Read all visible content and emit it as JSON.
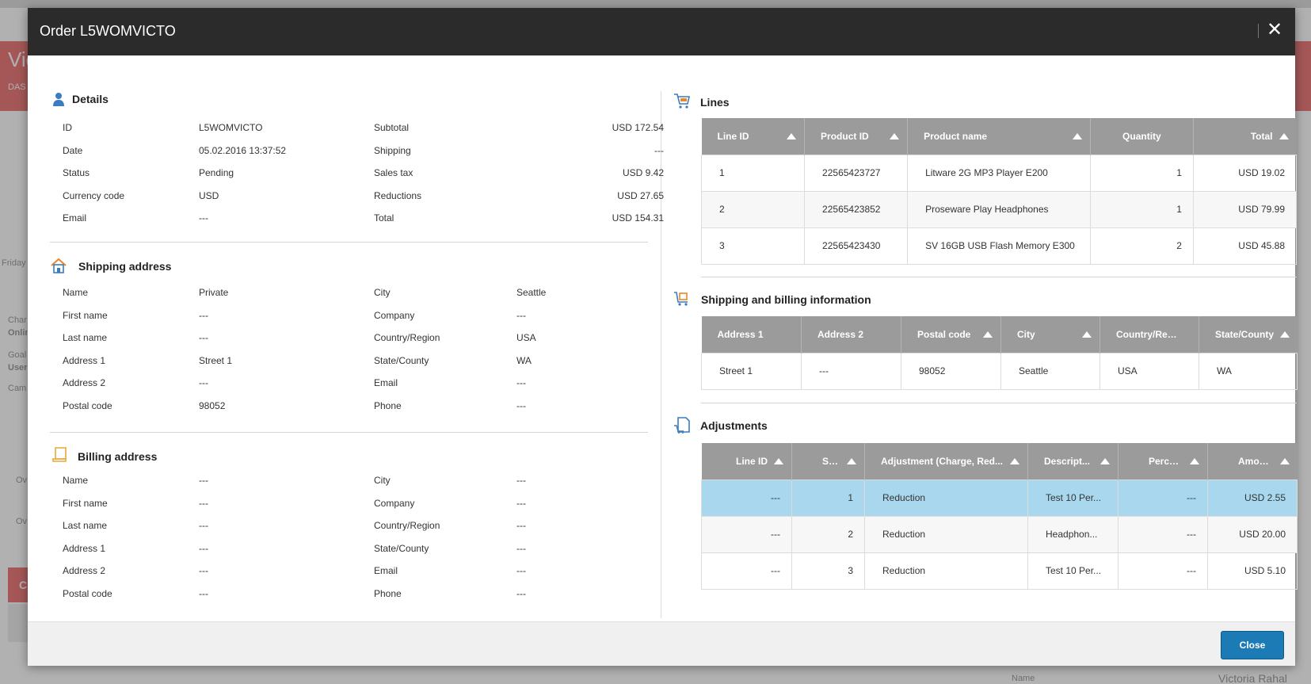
{
  "background": {
    "banner_title": "Vic",
    "banner_sub": "DAS",
    "side_texts": [
      "Friday S",
      "Char",
      "Onlin",
      "Goal",
      "User",
      "Cam",
      "Ov",
      "Ov",
      "C"
    ],
    "bottom_name_label": "Name",
    "bottom_name_value": "Victoria Rahal"
  },
  "dialog": {
    "title": "Order L5WOMVICTO",
    "close_button": "Close"
  },
  "details": {
    "title": "Details",
    "left": [
      {
        "label": "ID",
        "value": "L5WOMVICTO"
      },
      {
        "label": "Date",
        "value": "05.02.2016 13:37:52"
      },
      {
        "label": "Status",
        "value": "Pending"
      },
      {
        "label": "Currency code",
        "value": "USD"
      },
      {
        "label": "Email",
        "value": "---"
      }
    ],
    "right": [
      {
        "label": "Subtotal",
        "value": "USD 172.54"
      },
      {
        "label": "Shipping",
        "value": "---"
      },
      {
        "label": "Sales tax",
        "value": "USD 9.42"
      },
      {
        "label": "Reductions",
        "value": "USD 27.65"
      },
      {
        "label": "Total",
        "value": "USD 154.31"
      }
    ]
  },
  "shipping_address": {
    "title": "Shipping address",
    "left": [
      {
        "label": "Name",
        "value": "Private"
      },
      {
        "label": "First name",
        "value": "---"
      },
      {
        "label": "Last name",
        "value": "---"
      },
      {
        "label": "Address 1",
        "value": "Street 1"
      },
      {
        "label": "Address 2",
        "value": "---"
      },
      {
        "label": "Postal code",
        "value": "98052"
      }
    ],
    "right": [
      {
        "label": "City",
        "value": "Seattle"
      },
      {
        "label": "Company",
        "value": "---"
      },
      {
        "label": "Country/Region",
        "value": "USA"
      },
      {
        "label": "State/County",
        "value": "WA"
      },
      {
        "label": "Email",
        "value": "---"
      },
      {
        "label": "Phone",
        "value": "---"
      }
    ]
  },
  "billing_address": {
    "title": "Billing address",
    "left": [
      {
        "label": "Name",
        "value": "---"
      },
      {
        "label": "First name",
        "value": "---"
      },
      {
        "label": "Last name",
        "value": "---"
      },
      {
        "label": "Address 1",
        "value": "---"
      },
      {
        "label": "Address 2",
        "value": "---"
      },
      {
        "label": "Postal code",
        "value": "---"
      }
    ],
    "right": [
      {
        "label": "City",
        "value": "---"
      },
      {
        "label": "Company",
        "value": "---"
      },
      {
        "label": "Country/Region",
        "value": "---"
      },
      {
        "label": "State/County",
        "value": "---"
      },
      {
        "label": "Email",
        "value": "---"
      },
      {
        "label": "Phone",
        "value": "---"
      }
    ]
  },
  "lines": {
    "title": "Lines",
    "headers": [
      "Line ID",
      "Product ID",
      "Product name",
      "Quantity",
      "Total"
    ],
    "rows": [
      [
        "1",
        "22565423727",
        "Litware 2G MP3 Player E200",
        "1",
        "USD 19.02"
      ],
      [
        "2",
        "22565423852",
        "Proseware Play Headphones",
        "1",
        "USD 79.99"
      ],
      [
        "3",
        "22565423430",
        "SV 16GB USB Flash Memory E300",
        "2",
        "USD 45.88"
      ]
    ]
  },
  "shipping_billing": {
    "title": "Shipping and billing information",
    "headers": [
      "Address 1",
      "Address 2",
      "Postal code",
      "City",
      "Country/Region",
      "State/County"
    ],
    "rows": [
      [
        "Street 1",
        "---",
        "98052",
        "Seattle",
        "USA",
        "WA"
      ]
    ]
  },
  "adjustments": {
    "title": "Adjustments",
    "headers": [
      "Line ID",
      "Seq...",
      "Adjustment (Charge, Red...",
      "Descript...",
      "Percent...",
      "Amount"
    ],
    "rows": [
      [
        "---",
        "1",
        "Reduction",
        "Test 10 Per...",
        "---",
        "USD 2.55"
      ],
      [
        "---",
        "2",
        "Reduction",
        "Headphon...",
        "---",
        "USD 20.00"
      ],
      [
        "---",
        "3",
        "Reduction",
        "Test 10 Per...",
        "---",
        "USD 5.10"
      ]
    ]
  },
  "colors": {
    "header_bg": "#2b2b2b",
    "table_header_bg": "#9b9b9b",
    "selected_row": "#a9d8ee",
    "button_blue": "#1c7bb5"
  }
}
